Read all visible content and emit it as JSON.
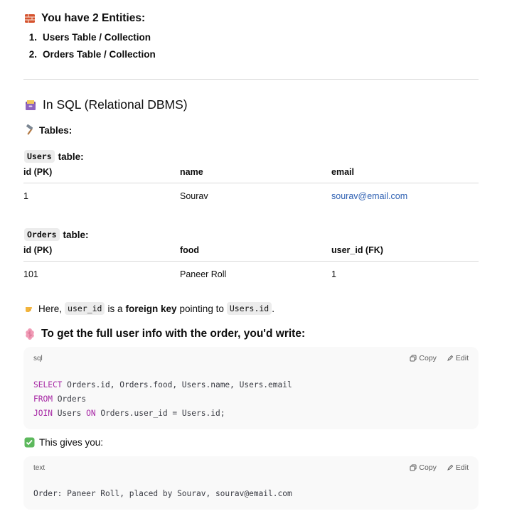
{
  "entities": {
    "heading": "You have 2 Entities:",
    "heading_icon": "brick-icon",
    "items": [
      {
        "num": "1.",
        "label": "Users Table / Collection"
      },
      {
        "num": "2.",
        "label": "Orders Table / Collection"
      }
    ]
  },
  "sql_section": {
    "heading": "In SQL (Relational DBMS)",
    "heading_icon": "card-file-box-icon",
    "tables_label": "Tables:",
    "tables_icon": "hammer-icon"
  },
  "users_table": {
    "code_name": "Users",
    "suffix": "table:",
    "headers": [
      "id (PK)",
      "name",
      "email"
    ],
    "rows": [
      [
        "1",
        "Sourav",
        "sourav@email.com"
      ]
    ]
  },
  "orders_table": {
    "code_name": "Orders",
    "suffix": "table:",
    "headers": [
      "id (PK)",
      "food",
      "user_id (FK)"
    ],
    "rows": [
      [
        "101",
        "Paneer Roll",
        "1"
      ]
    ]
  },
  "fk_note": {
    "icon": "pointing-hand-icon",
    "text1": "Here,",
    "code1": "user_id",
    "text2": "is a",
    "bold": "foreign key",
    "text3": "pointing to",
    "code2": "Users.id",
    "text4": "."
  },
  "join_heading": {
    "icon": "brain-icon",
    "text": "To get the full user info with the order, you'd write:"
  },
  "sql_code": {
    "lang": "sql",
    "copy_label": "Copy",
    "edit_label": "Edit",
    "lines": [
      [
        {
          "k": true,
          "t": "SELECT"
        },
        {
          "k": false,
          "t": " Orders.id, Orders.food, Users.name, Users.email"
        }
      ],
      [
        {
          "k": true,
          "t": "FROM"
        },
        {
          "k": false,
          "t": " Orders"
        }
      ],
      [
        {
          "k": true,
          "t": "JOIN"
        },
        {
          "k": false,
          "t": " Users "
        },
        {
          "k": true,
          "t": "ON"
        },
        {
          "k": false,
          "t": " Orders.user_id = Users.id;"
        }
      ]
    ]
  },
  "result_note": {
    "icon": "check-mark-icon",
    "text": "This gives you:"
  },
  "text_code": {
    "lang": "text",
    "copy_label": "Copy",
    "edit_label": "Edit",
    "content": "Order: Paneer Roll, placed by Sourav, sourav@email.com"
  },
  "colors": {
    "link": "#2f61b3",
    "keyword": "#a626a4",
    "code_bg": "#f9f9f9"
  }
}
